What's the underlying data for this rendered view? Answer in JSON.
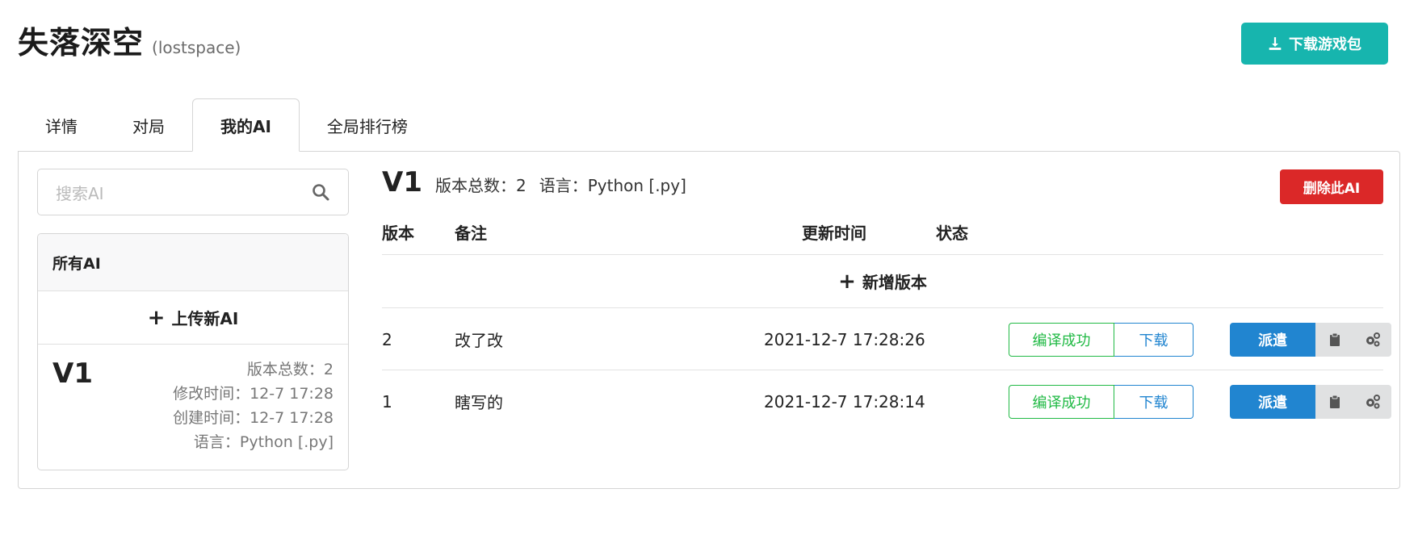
{
  "header": {
    "title": "失落深空",
    "subtitle": "(lostspace)",
    "download_button": "下载游戏包",
    "download_icon": "download-icon"
  },
  "tabs": [
    {
      "label": "详情",
      "active": false
    },
    {
      "label": "对局",
      "active": false
    },
    {
      "label": "我的AI",
      "active": true
    },
    {
      "label": "全局排行榜",
      "active": false
    }
  ],
  "sidebar": {
    "search_placeholder": "搜索AI",
    "search_icon": "search-icon",
    "list_title": "所有AI",
    "upload_label": "上传新AI",
    "ai_items": [
      {
        "name": "V1",
        "versions": "版本总数：2",
        "modified": "修改时间：12-7 17:28",
        "created": "创建时间：12-7 17:28",
        "language": "语言：Python [.py]"
      }
    ]
  },
  "detail": {
    "ai_name": "V1",
    "version_count": "版本总数：2",
    "language": "语言：Python [.py]",
    "delete_button": "删除此AI",
    "columns": {
      "version": "版本",
      "note": "备注",
      "updated": "更新时间",
      "status": "状态"
    },
    "add_version_label": "新增版本",
    "rows": [
      {
        "version": "2",
        "note": "改了改",
        "updated": "2021-12-7 17:28:26",
        "status": "编译成功",
        "download": "下载",
        "dispatch": "派遣"
      },
      {
        "version": "1",
        "note": "瞎写的",
        "updated": "2021-12-7 17:28:14",
        "status": "编译成功",
        "download": "下载",
        "dispatch": "派遣"
      }
    ]
  },
  "colors": {
    "teal": "#17b5ae",
    "red": "#db2828",
    "blue": "#2185d0",
    "green": "#21ba45",
    "grey_button": "#e0e1e2"
  }
}
